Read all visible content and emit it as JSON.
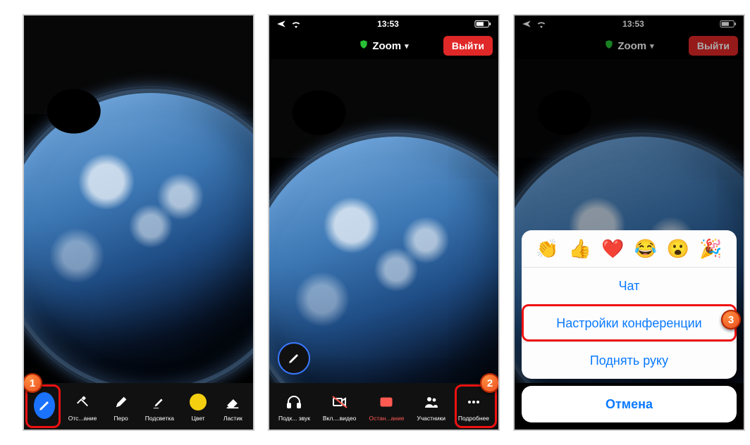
{
  "status": {
    "time": "13:53"
  },
  "nav": {
    "title": "Zoom",
    "exit": "Выйти"
  },
  "annot_toolbar": {
    "items": [
      {
        "id": "edit",
        "label": ""
      },
      {
        "id": "undo",
        "label": "Отс...ание"
      },
      {
        "id": "pen",
        "label": "Перо"
      },
      {
        "id": "highlight",
        "label": "Подсветка"
      },
      {
        "id": "color",
        "label": "Цвет"
      },
      {
        "id": "eraser",
        "label": "Ластик"
      }
    ]
  },
  "meeting_toolbar": {
    "items": [
      {
        "id": "audio",
        "label": "Подк... звук"
      },
      {
        "id": "video",
        "label": "Вкл....видео"
      },
      {
        "id": "stop",
        "label": "Остан...ание"
      },
      {
        "id": "participants",
        "label": "Участники"
      },
      {
        "id": "more",
        "label": "Подробнее"
      }
    ]
  },
  "sheet": {
    "reactions": [
      "👏",
      "👍",
      "❤️",
      "😂",
      "😮",
      "🎉"
    ],
    "chat": "Чат",
    "settings": "Настройки конференции",
    "raise": "Поднять руку",
    "cancel": "Отмена"
  },
  "badges": {
    "b1": "1",
    "b2": "2",
    "b3": "3"
  }
}
